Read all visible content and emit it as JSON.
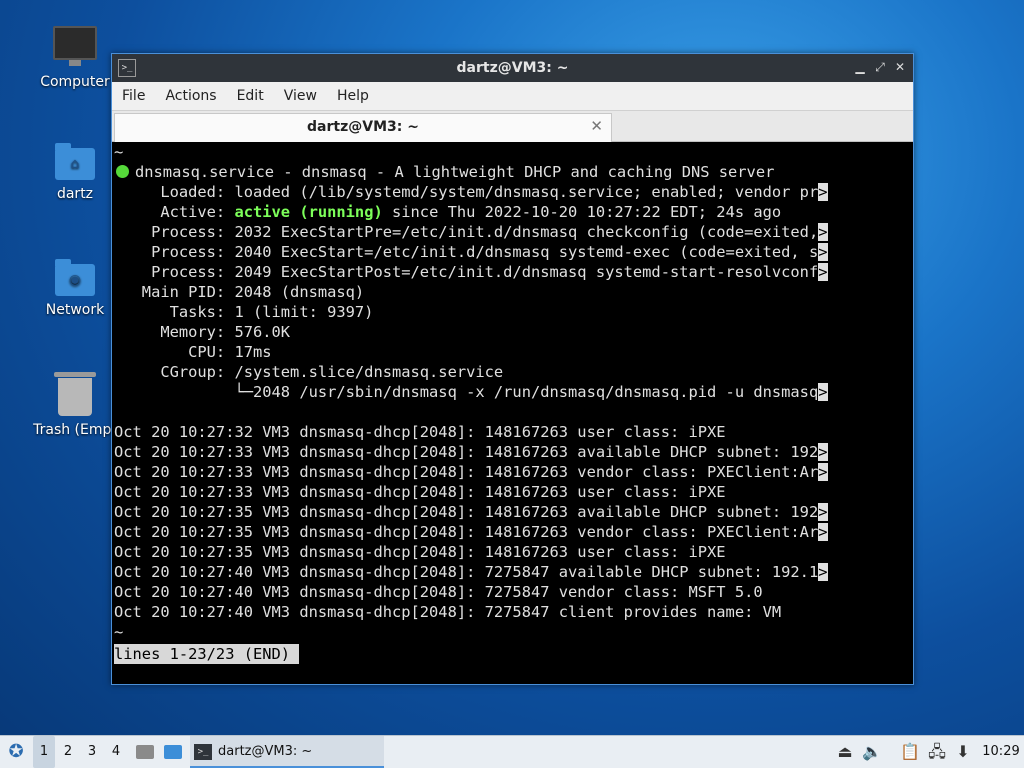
{
  "desktop": {
    "icons": [
      {
        "label": "Computer"
      },
      {
        "label": "dartz"
      },
      {
        "label": "Network"
      },
      {
        "label": "Trash (Empt"
      }
    ]
  },
  "window": {
    "title": "dartz@VM3: ~",
    "title_icon": "terminal-icon",
    "controls": {
      "minimize": "▁",
      "maximize": "⤢",
      "close": "✕"
    },
    "menu": [
      "File",
      "Edit",
      "View",
      "Help"
    ],
    "menu_full": [
      "File",
      "Actions",
      "Edit",
      "View",
      "Help"
    ],
    "tab": {
      "label": "dartz@VM3: ~",
      "close": "✕"
    }
  },
  "terminal": {
    "lines": [
      {
        "text": "~"
      },
      {
        "dot": true,
        "text": "dnsmasq.service - dnsmasq - A lightweight DHCP and caching DNS server"
      },
      {
        "text": "     Loaded: loaded (/lib/systemd/system/dnsmasq.service; enabled; vendor pr",
        "trunc": true
      },
      {
        "prefix": "     Active: ",
        "green": "active (running)",
        "suffix": " since Thu 2022-10-20 10:27:22 EDT; 24s ago"
      },
      {
        "text": "    Process: 2032 ExecStartPre=/etc/init.d/dnsmasq checkconfig (code=exited,",
        "trunc": true
      },
      {
        "text": "    Process: 2040 ExecStart=/etc/init.d/dnsmasq systemd-exec (code=exited, s",
        "trunc": true
      },
      {
        "text": "    Process: 2049 ExecStartPost=/etc/init.d/dnsmasq systemd-start-resolvconf",
        "trunc": true
      },
      {
        "text": "   Main PID: 2048 (dnsmasq)"
      },
      {
        "text": "      Tasks: 1 (limit: 9397)"
      },
      {
        "text": "     Memory: 576.0K"
      },
      {
        "text": "        CPU: 17ms"
      },
      {
        "text": "     CGroup: /system.slice/dnsmasq.service"
      },
      {
        "text": "             └─2048 /usr/sbin/dnsmasq -x /run/dnsmasq/dnsmasq.pid -u dnsmasq",
        "trunc": true
      },
      {
        "text": ""
      },
      {
        "text": "Oct 20 10:27:32 VM3 dnsmasq-dhcp[2048]: 148167263 user class: iPXE"
      },
      {
        "text": "Oct 20 10:27:33 VM3 dnsmasq-dhcp[2048]: 148167263 available DHCP subnet: 192",
        "trunc": true
      },
      {
        "text": "Oct 20 10:27:33 VM3 dnsmasq-dhcp[2048]: 148167263 vendor class: PXEClient:Ar",
        "trunc": true
      },
      {
        "text": "Oct 20 10:27:33 VM3 dnsmasq-dhcp[2048]: 148167263 user class: iPXE"
      },
      {
        "text": "Oct 20 10:27:35 VM3 dnsmasq-dhcp[2048]: 148167263 available DHCP subnet: 192",
        "trunc": true
      },
      {
        "text": "Oct 20 10:27:35 VM3 dnsmasq-dhcp[2048]: 148167263 vendor class: PXEClient:Ar",
        "trunc": true
      },
      {
        "text": "Oct 20 10:27:35 VM3 dnsmasq-dhcp[2048]: 148167263 user class: iPXE"
      },
      {
        "text": "Oct 20 10:27:40 VM3 dnsmasq-dhcp[2048]: 7275847 available DHCP subnet: 192.1",
        "trunc": true
      },
      {
        "text": "Oct 20 10:27:40 VM3 dnsmasq-dhcp[2048]: 7275847 vendor class: MSFT 5.0"
      },
      {
        "text": "Oct 20 10:27:40 VM3 dnsmasq-dhcp[2048]: 7275847 client provides name: VM"
      },
      {
        "text": "~"
      }
    ],
    "truncation_marker": ">",
    "status_line": "lines 1-23/23 (END) "
  },
  "taskbar": {
    "start_icon": "start-menu-icon",
    "workspaces": [
      "1",
      "2",
      "3",
      "4"
    ],
    "active_workspace": "1",
    "task_label": "dartz@VM3: ~",
    "clock": "10:29",
    "tray_icons": [
      "eject-icon",
      "volume-icon",
      "clipboard-icon",
      "network-icon",
      "update-icon"
    ]
  },
  "colors": {
    "accent": "#4a90d9",
    "status_green": "#55d93a",
    "terminal_bg": "#000000"
  }
}
